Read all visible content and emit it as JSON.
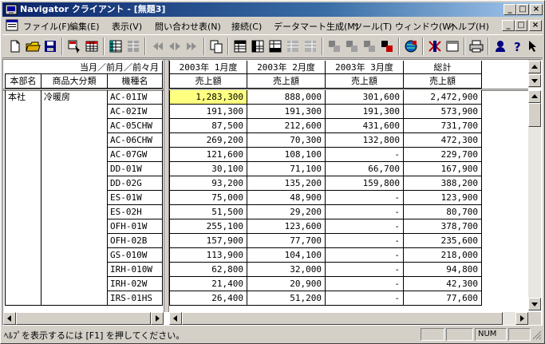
{
  "window": {
    "title": "Navigator クライアント - [無題3]"
  },
  "title_buttons": {
    "minimize": "_",
    "maximize": "□",
    "close": "×"
  },
  "menu": [
    {
      "label": "ファイル(F)"
    },
    {
      "label": "編集(E)"
    },
    {
      "label": "表示(V)"
    },
    {
      "label": "問い合わせ表(N)"
    },
    {
      "label": "接続(C)"
    },
    {
      "label": "データマート生成(M)"
    },
    {
      "label": "ツール(T)"
    },
    {
      "label": "ウィンドウ(W)"
    },
    {
      "label": "ヘルプ(H)"
    }
  ],
  "table": {
    "corner_top": "当月／前月／前々月",
    "row_headers": [
      "本部名",
      "商品大分類",
      "機種名"
    ],
    "columns": [
      {
        "period": "2003年 1月度",
        "measure": "売上額"
      },
      {
        "period": "2003年 2月度",
        "measure": "売上額"
      },
      {
        "period": "2003年 3月度",
        "measure": "売上額"
      },
      {
        "period": "総計",
        "measure": "売上額"
      }
    ],
    "honbu": "本社",
    "bunrui": "冷暖房",
    "rows": [
      {
        "model": "AC-01IW",
        "values": [
          "1,283,300",
          "888,000",
          "301,600",
          "2,472,900"
        ]
      },
      {
        "model": "AC-02IW",
        "values": [
          "191,300",
          "191,300",
          "191,300",
          "573,900"
        ]
      },
      {
        "model": "AC-05CHW",
        "values": [
          "87,500",
          "212,600",
          "431,600",
          "731,700"
        ]
      },
      {
        "model": "AC-06CHW",
        "values": [
          "269,200",
          "70,300",
          "132,800",
          "472,300"
        ]
      },
      {
        "model": "AC-07GW",
        "values": [
          "121,600",
          "108,100",
          "-",
          "229,700"
        ]
      },
      {
        "model": "DD-01W",
        "values": [
          "30,100",
          "71,100",
          "66,700",
          "167,900"
        ]
      },
      {
        "model": "DD-02G",
        "values": [
          "93,200",
          "135,200",
          "159,800",
          "388,200"
        ]
      },
      {
        "model": "ES-01W",
        "values": [
          "75,000",
          "48,900",
          "-",
          "123,900"
        ]
      },
      {
        "model": "ES-02H",
        "values": [
          "51,500",
          "29,200",
          "-",
          "80,700"
        ]
      },
      {
        "model": "OFH-01W",
        "values": [
          "255,100",
          "123,600",
          "-",
          "378,700"
        ]
      },
      {
        "model": "OFH-02B",
        "values": [
          "157,900",
          "77,700",
          "-",
          "235,600"
        ]
      },
      {
        "model": "GS-010W",
        "values": [
          "113,900",
          "104,100",
          "-",
          "218,000"
        ]
      },
      {
        "model": "IRH-010W",
        "values": [
          "62,800",
          "32,000",
          "-",
          "94,800"
        ]
      },
      {
        "model": "IRH-02W",
        "values": [
          "21,400",
          "20,900",
          "-",
          "42,300"
        ]
      },
      {
        "model": "IRS-01HS",
        "values": [
          "26,400",
          "51,200",
          "-",
          "77,600"
        ]
      }
    ]
  },
  "status": {
    "text": "ﾍﾙﾌﾟを表示するには [F1] を押してください。",
    "num": "NUM"
  },
  "colors": {
    "selected_cell": "#ffff80",
    "title_start": "#0a246a",
    "title_end": "#a6caf0"
  }
}
